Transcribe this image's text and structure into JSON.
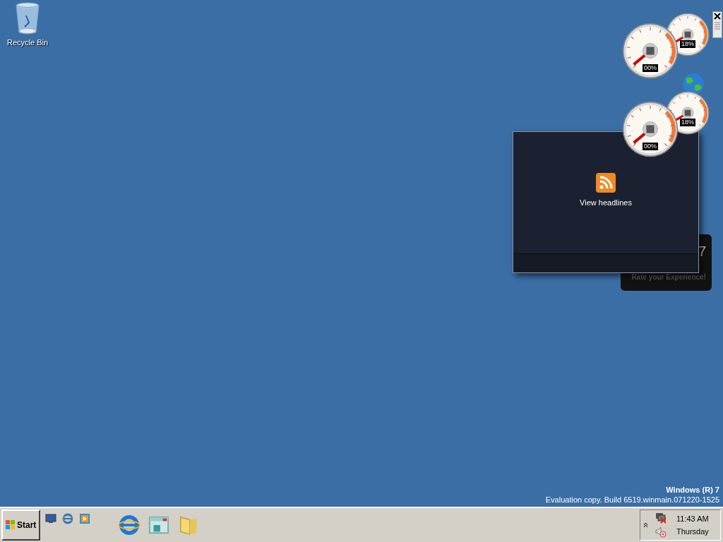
{
  "desktop_icons": [
    {
      "label": "Recycle Bin"
    }
  ],
  "gadgets": [
    {
      "kind": "cpu_meter",
      "cpu_reading": "00%",
      "memory_reading": "18%"
    },
    {
      "kind": "globe"
    },
    {
      "kind": "cpu_meter",
      "cpu_reading": "00%",
      "memory_reading": "18%"
    },
    {
      "kind": "rating",
      "number": "7",
      "caption": "Rate your Experience!"
    },
    {
      "kind": "feed",
      "label": "View headlines"
    }
  ],
  "watermark": {
    "title": "Windows (R) 7",
    "build": "Evaluation copy. Build 6519.winmain.071220-1525"
  },
  "taskbar": {
    "start": "Start",
    "quick_launch": [
      {
        "kind": "desktop"
      },
      {
        "kind": "browser"
      },
      {
        "kind": "media"
      }
    ],
    "pinned": [
      {
        "kind": "browser"
      },
      {
        "kind": "media-center"
      },
      {
        "kind": "folder"
      }
    ],
    "clock": {
      "time": "11:43 AM",
      "day": "Thursday"
    }
  }
}
